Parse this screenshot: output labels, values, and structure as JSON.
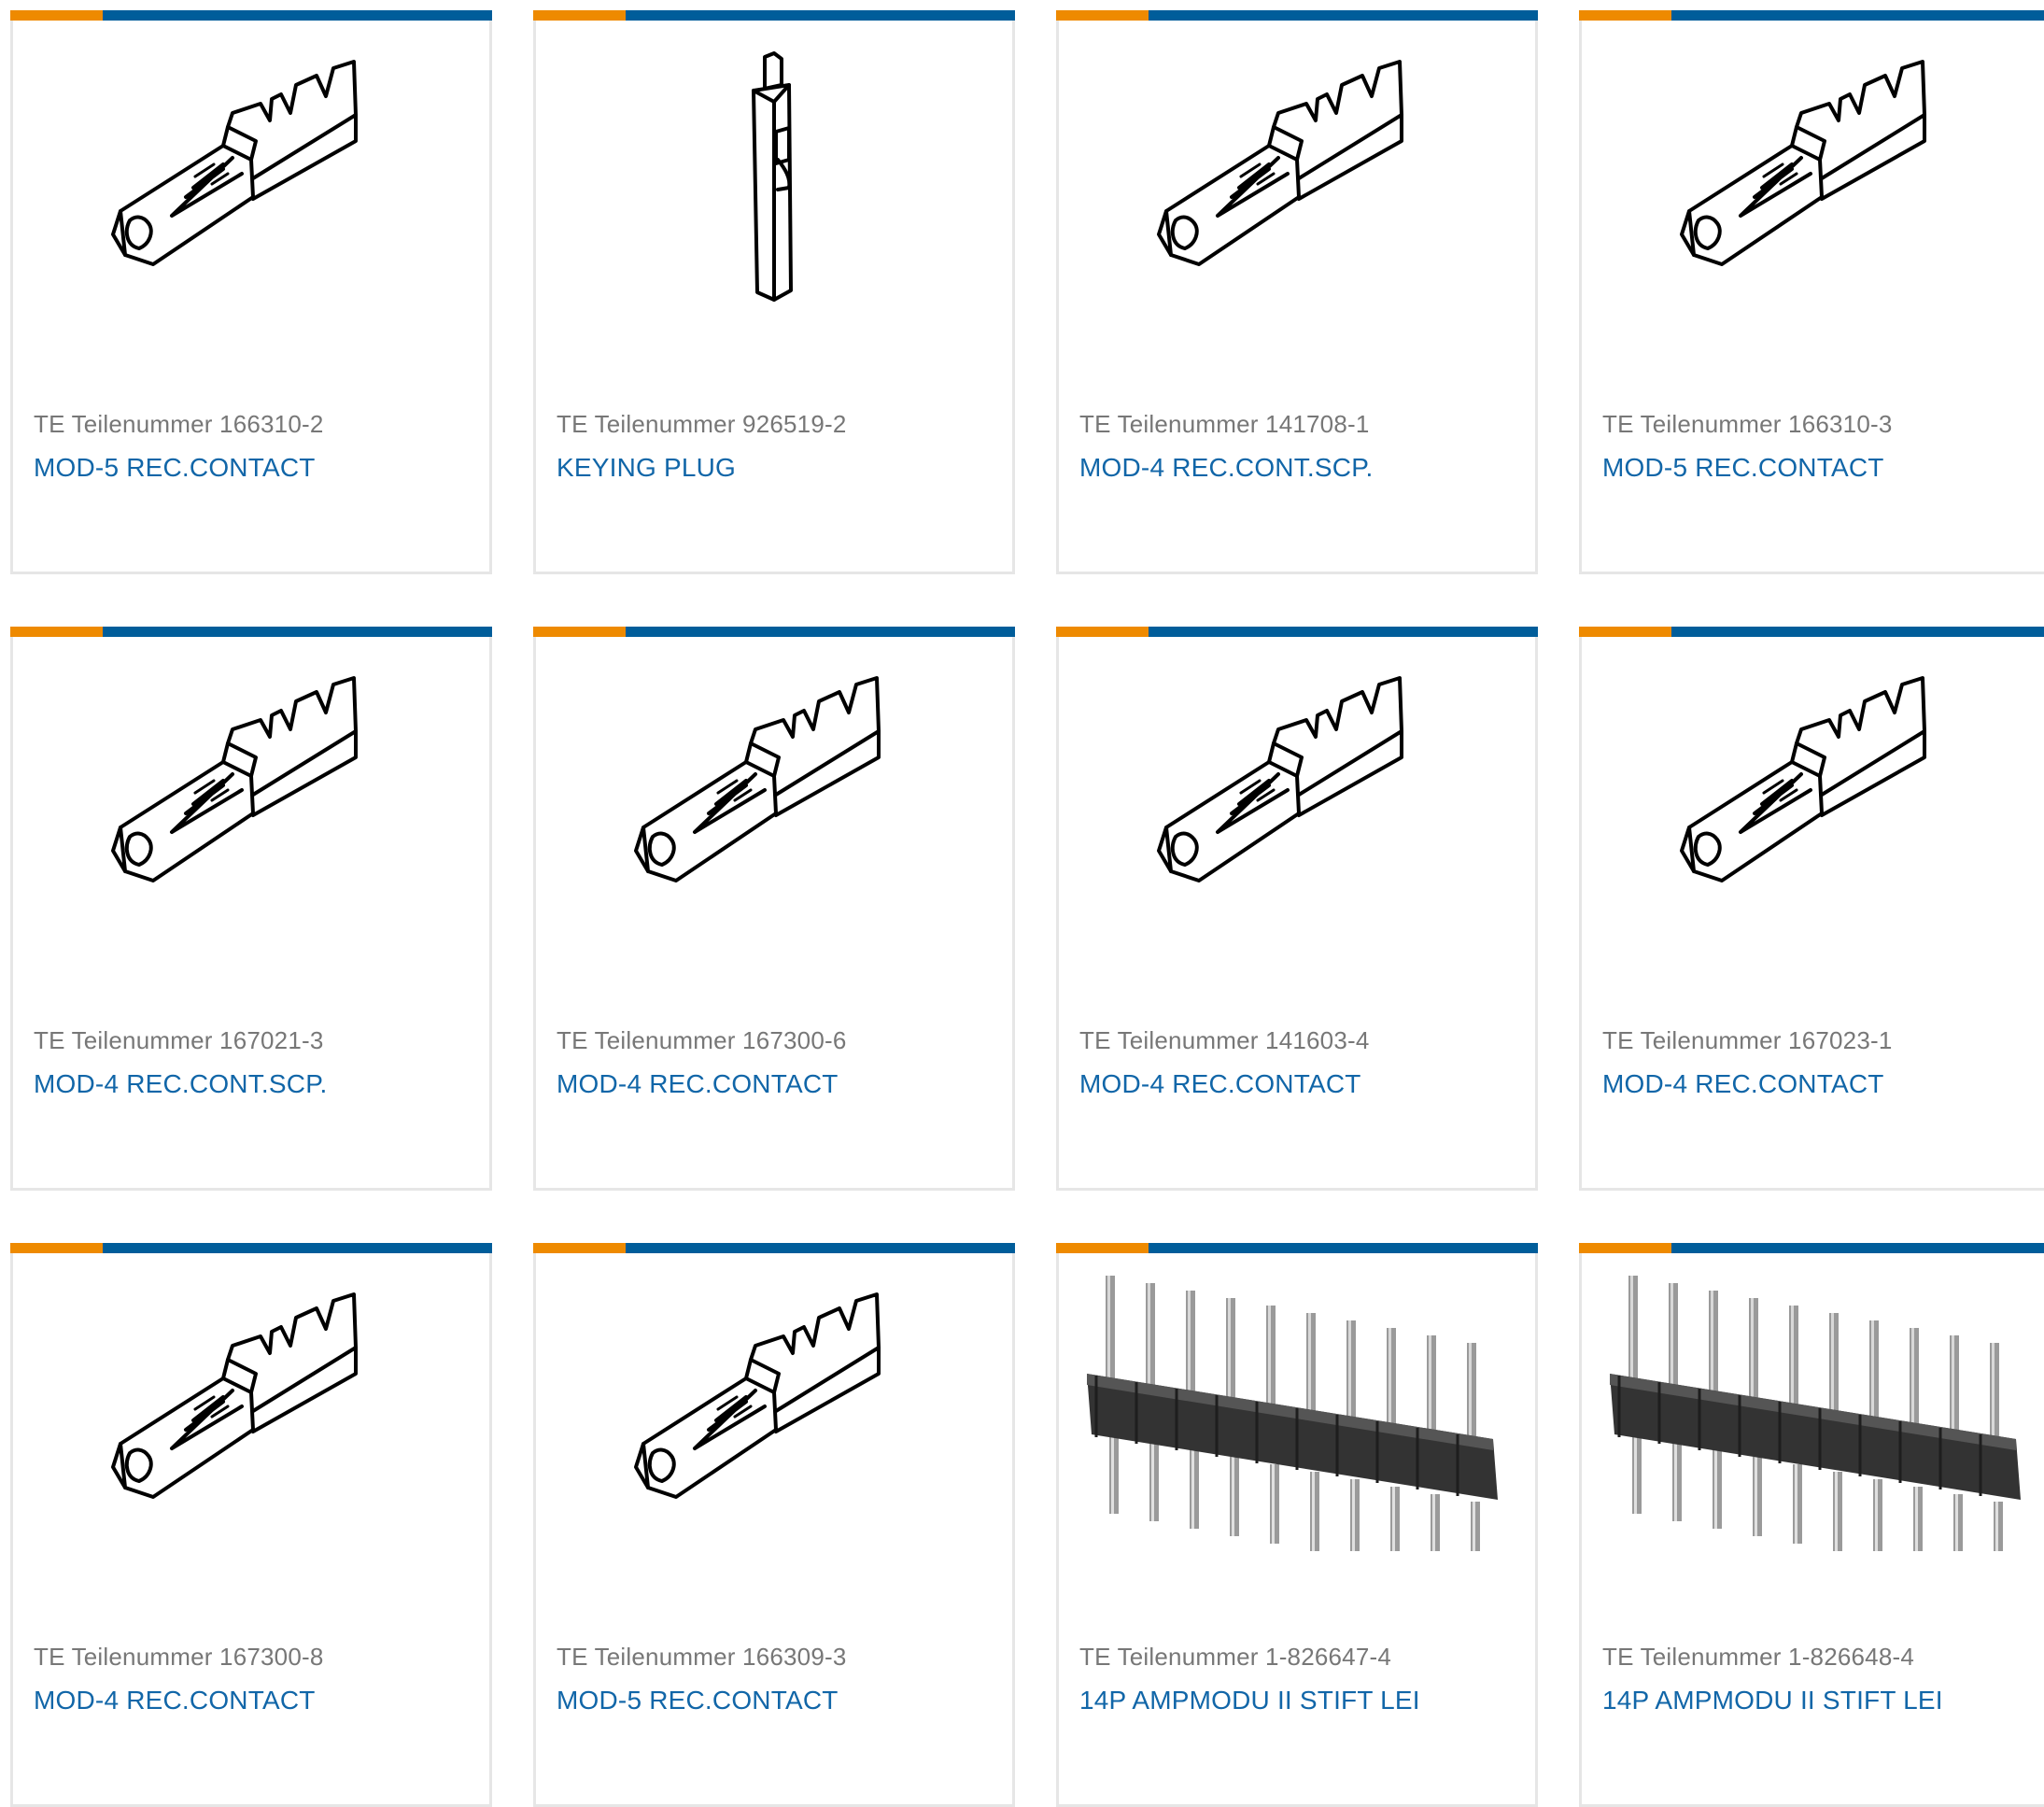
{
  "colors": {
    "accent": "#ee8a00",
    "brand": "#005d9a",
    "link": "#1166a8",
    "meta": "#777777",
    "border": "#e6e6e6"
  },
  "products": [
    {
      "part_label": "TE Teilenummer 166310-2",
      "description": "MOD-5 REC.CONTACT",
      "image": "receptacle-contact-icon"
    },
    {
      "part_label": "TE Teilenummer 926519-2",
      "description": "KEYING PLUG",
      "image": "keying-plug-icon"
    },
    {
      "part_label": "TE Teilenummer 141708-1",
      "description": "MOD-4 REC.CONT.SCP.",
      "image": "receptacle-contact-icon"
    },
    {
      "part_label": "TE Teilenummer 166310-3",
      "description": "MOD-5 REC.CONTACT",
      "image": "receptacle-contact-icon"
    },
    {
      "part_label": "TE Teilenummer 167021-3",
      "description": "MOD-4 REC.CONT.SCP.",
      "image": "receptacle-contact-icon"
    },
    {
      "part_label": "TE Teilenummer 167300-6",
      "description": "MOD-4 REC.CONTACT",
      "image": "receptacle-contact-icon"
    },
    {
      "part_label": "TE Teilenummer 141603-4",
      "description": "MOD-4 REC.CONTACT",
      "image": "receptacle-contact-icon"
    },
    {
      "part_label": "TE Teilenummer 167023-1",
      "description": "MOD-4 REC.CONTACT",
      "image": "receptacle-contact-icon"
    },
    {
      "part_label": "TE Teilenummer 167300-8",
      "description": "MOD-4 REC.CONTACT",
      "image": "receptacle-contact-icon"
    },
    {
      "part_label": "TE Teilenummer 166309-3",
      "description": "MOD-5 REC.CONTACT",
      "image": "receptacle-contact-icon"
    },
    {
      "part_label": "TE Teilenummer 1-826647-4",
      "description": "14P AMPMODU II STIFT LEI",
      "image": "pin-header-icon"
    },
    {
      "part_label": "TE Teilenummer 1-826648-4",
      "description": "14P AMPMODU II STIFT LEI",
      "image": "pin-header-icon"
    }
  ]
}
